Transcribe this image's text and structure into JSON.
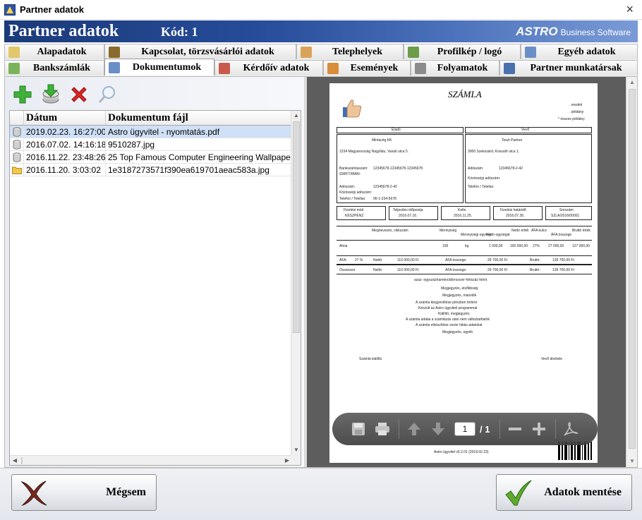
{
  "window": {
    "title": "Partner adatok",
    "close": "×"
  },
  "header": {
    "title": "Partner adatok",
    "kod_label": "Kód: 1",
    "brand_astro": "ASTRO",
    "brand_bs": "Business Software"
  },
  "tabs": {
    "row1": [
      {
        "label": "Alapadatok",
        "icon": "form-icon",
        "color": "#e2c66a"
      },
      {
        "label": "Kapcsolat, törzsvásárlói adatok",
        "icon": "contact-book-icon",
        "color": "#8a6b2d"
      },
      {
        "label": "Telephelyek",
        "icon": "house-icon",
        "color": "#d9a35a"
      },
      {
        "label": "Profilkép / logó",
        "icon": "picture-icon",
        "color": "#6b9c4a"
      },
      {
        "label": "Egyéb adatok",
        "icon": "list-icon",
        "color": "#6a8fc7"
      }
    ],
    "row2": [
      {
        "label": "Bankszámlák",
        "icon": "money-icon",
        "color": "#7bb35a"
      },
      {
        "label": "Dokumentumok",
        "icon": "documents-icon",
        "color": "#6a8fc7",
        "active": true
      },
      {
        "label": "Kérdőív adatok",
        "icon": "questionnaire-icon",
        "color": "#c95a4a"
      },
      {
        "label": "Események",
        "icon": "calendar-icon",
        "color": "#d98c3a"
      },
      {
        "label": "Folyamatok",
        "icon": "process-icon",
        "color": "#8c8c8c"
      },
      {
        "label": "Partner munkatársak",
        "icon": "person-icon",
        "color": "#4a70b0"
      }
    ]
  },
  "toolbar": {
    "add": "add-icon",
    "download": "download-icon",
    "delete": "delete-icon",
    "view": "magnifier-icon"
  },
  "grid": {
    "columns": [
      "Dátum",
      "Dokumentum fájl"
    ],
    "rows": [
      {
        "date": "2019.02.23. 16:27:00",
        "file": "Astro ügyvitel - nyomtatás.pdf",
        "type": "file",
        "selected": true
      },
      {
        "date": "2016.07.02. 14:16:18",
        "file": "9510287.jpg",
        "type": "file"
      },
      {
        "date": "2016.11.22. 23:48:26",
        "file": "25 Top Famous Computer Engineering Wallpaper.jpg",
        "type": "file"
      },
      {
        "date": "2016.11.20. 3:03:02",
        "file": "1e3187273571f390ea619701aeac583a.jpg",
        "type": "folder"
      }
    ]
  },
  "pdf": {
    "doc_title": "SZÁMLA",
    "flags": [
      ". eredeti",
      ". példány",
      "* összes példány"
    ],
    "seller_header": "Eladó",
    "buyer_header": "Vevő",
    "seller_name": "Mintacég Kft.",
    "buyer_name": "Teszt Partner",
    "seller_address": "1234 Magyarország Nagyfalu, Vasúti utca 5.",
    "buyer_address": "3000 Szekszárd, Kossuth utca 1.",
    "bank_label": "Bankszámlaszám:",
    "bank_value": "12345678-12345678-12345678",
    "swift_label": "SWIFT/IBAN:",
    "tax_label": "Adószám:",
    "tax_value": "12345678-2-42",
    "eu_tax_label": "Közösségi adószám:",
    "phone_label": "Telefon / Telefax:",
    "phone_value": "06-1-234-5678",
    "summary_labels": [
      "Fizetési mód",
      "Teljesítés időpontja",
      "Kelte",
      "Fizetési határidő",
      "Sorszám"
    ],
    "summary_values": [
      "KÉSZPÉNZ",
      "2016.07.16.",
      "2016.11.25.",
      "2016.07.26.",
      "SZLA/2016/00001"
    ],
    "item_cols": [
      "Megnevezés, cikkszám",
      "Mennyiség",
      "Mennyiségi egység",
      "Nettó egységár",
      "Nettó érték",
      "ÁFA kulcs",
      "ÁFA összege",
      "Bruttó érték"
    ],
    "item_row": [
      "Alma",
      "100",
      "kg",
      "1 000,00",
      "100 000,00",
      "27%",
      "27 000,00",
      "127 000,00"
    ],
    "vat_label": "ÁFA:",
    "vat_rate": "27 %",
    "net_label": "Nettó:",
    "net_value": "110 000,00 Ft",
    "vat_sum_label": "ÁFA összege:",
    "vat_sum_value": "29 700,00 Ft",
    "gross_label": "Bruttó:",
    "gross_value": "139 700,00 Ft",
    "total_label": "Összesen:",
    "notes": [
      "azaz: egyszázharminckilencezer-hétszáz forint",
      "Megjegyzés, elsőbbség",
      "Megjegyzés, második",
      "A számla kiegyenlítése pénzben történt",
      "Készült az Astro ügyviteli programmal",
      "Kiállító, megjegyzés",
      "A számla adatai a számlázás után nem változtathatók",
      "A számla elkészítése során hibás adatokat",
      "Megjegyzés, egyéb"
    ],
    "sign_left": "Számla kiállító",
    "sign_right": "Vevő átvétele",
    "footer": "Astro ügyvitel v5.2.01 (2019.02.23)"
  },
  "pdfbar": {
    "page_current": "1",
    "page_total": "/ 1"
  },
  "buttons": {
    "cancel": "Mégsem",
    "save": "Adatok mentése"
  }
}
